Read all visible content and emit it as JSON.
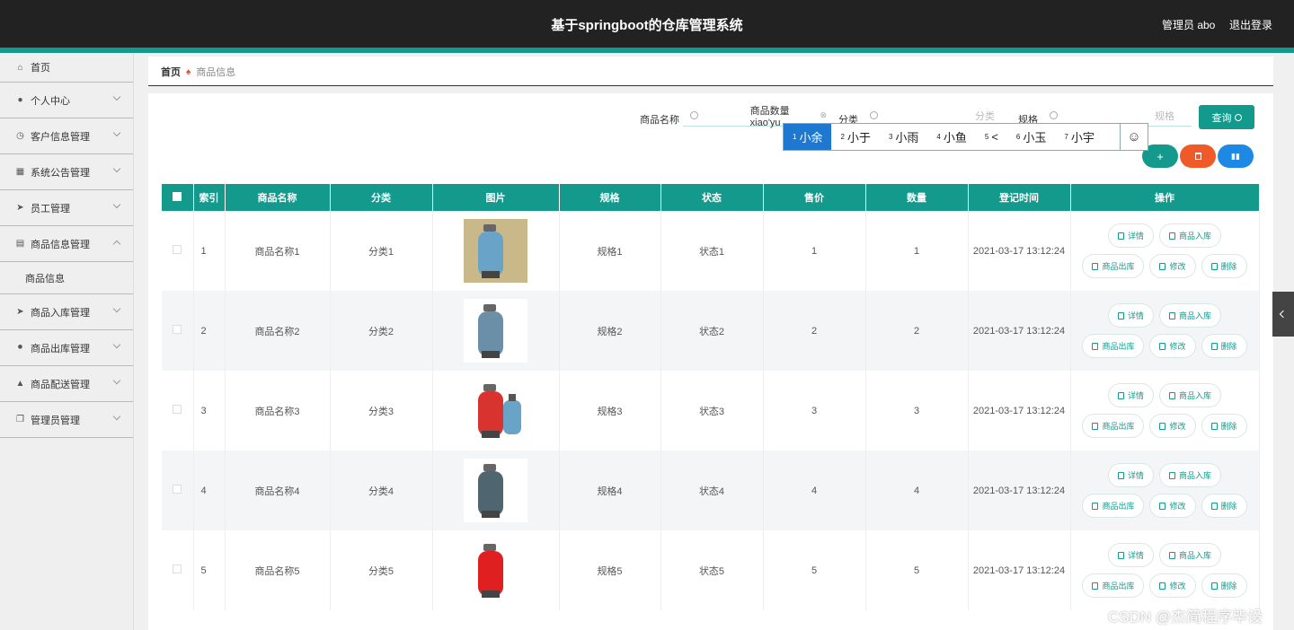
{
  "header": {
    "title": "基于springboot的仓库管理系统",
    "user": "管理员 abo",
    "logout": "退出登录"
  },
  "sidebar": {
    "items": [
      {
        "label": "首页",
        "icon": "home-icon",
        "expandable": false
      },
      {
        "label": "个人中心",
        "icon": "user-icon",
        "expandable": true
      },
      {
        "label": "客户信息管理",
        "icon": "clock-icon",
        "expandable": true
      },
      {
        "label": "系统公告管理",
        "icon": "briefcase-icon",
        "expandable": true
      },
      {
        "label": "员工管理",
        "icon": "send-icon",
        "expandable": true
      },
      {
        "label": "商品信息管理",
        "icon": "message-icon",
        "expandable": true,
        "expanded": true,
        "sub": "商品信息"
      },
      {
        "label": "商品入库管理",
        "icon": "paper-plane-icon",
        "expandable": true
      },
      {
        "label": "商品出库管理",
        "icon": "mic-icon",
        "expandable": true
      },
      {
        "label": "商品配送管理",
        "icon": "chart-icon",
        "expandable": true
      },
      {
        "label": "管理员管理",
        "icon": "copy-icon",
        "expandable": true
      }
    ]
  },
  "breadcrumb": {
    "home": "首页",
    "current": "商品信息"
  },
  "search": {
    "name_label": "商品名称",
    "name_value": "商品数量xiao'yu",
    "category_label": "分类",
    "category_placeholder": "分类",
    "spec_label": "规格",
    "spec_placeholder": "规格",
    "query_button": "查询"
  },
  "ime": {
    "candidates": [
      {
        "n": "1",
        "t": "小余",
        "selected": true
      },
      {
        "n": "2",
        "t": "小于"
      },
      {
        "n": "3",
        "t": "小雨"
      },
      {
        "n": "4",
        "t": "小鱼"
      },
      {
        "n": "5",
        "t": "<"
      },
      {
        "n": "6",
        "t": "小玉"
      },
      {
        "n": "7",
        "t": "小宇"
      }
    ],
    "emoji": "☺"
  },
  "table": {
    "columns": [
      "索引",
      "商品名称",
      "分类",
      "图片",
      "规格",
      "状态",
      "售价",
      "数量",
      "登记时间",
      "操作"
    ],
    "rows": [
      {
        "index": "1",
        "name": "商品名称1",
        "category": "分类1",
        "spec": "规格1",
        "status": "状态1",
        "price": "1",
        "qty": "1",
        "time": "2021-03-17 13:12:24",
        "img": "blue-small"
      },
      {
        "index": "2",
        "name": "商品名称2",
        "category": "分类2",
        "spec": "规格2",
        "status": "状态2",
        "price": "2",
        "qty": "2",
        "time": "2021-03-17 13:12:24",
        "img": "blue-tall"
      },
      {
        "index": "3",
        "name": "商品名称3",
        "category": "分类3",
        "spec": "规格3",
        "status": "状态3",
        "price": "3",
        "qty": "3",
        "time": "2021-03-17 13:12:24",
        "img": "red-blue"
      },
      {
        "index": "4",
        "name": "商品名称4",
        "category": "分类4",
        "spec": "规格4",
        "status": "状态4",
        "price": "4",
        "qty": "4",
        "time": "2021-03-17 13:12:24",
        "img": "grey"
      },
      {
        "index": "5",
        "name": "商品名称5",
        "category": "分类5",
        "spec": "规格5",
        "status": "状态5",
        "price": "5",
        "qty": "5",
        "time": "2021-03-17 13:12:24",
        "img": "red"
      }
    ],
    "ops": {
      "detail": "详情",
      "stock_in": "商品入库",
      "stock_out": "商品出库",
      "edit": "修改",
      "delete": "删除"
    }
  },
  "watermark": "CSDN @杰简程序毕设",
  "colors": {
    "accent": "#139a8c",
    "danger": "#f05a28",
    "info": "#1e88e5",
    "header": "#222222"
  }
}
